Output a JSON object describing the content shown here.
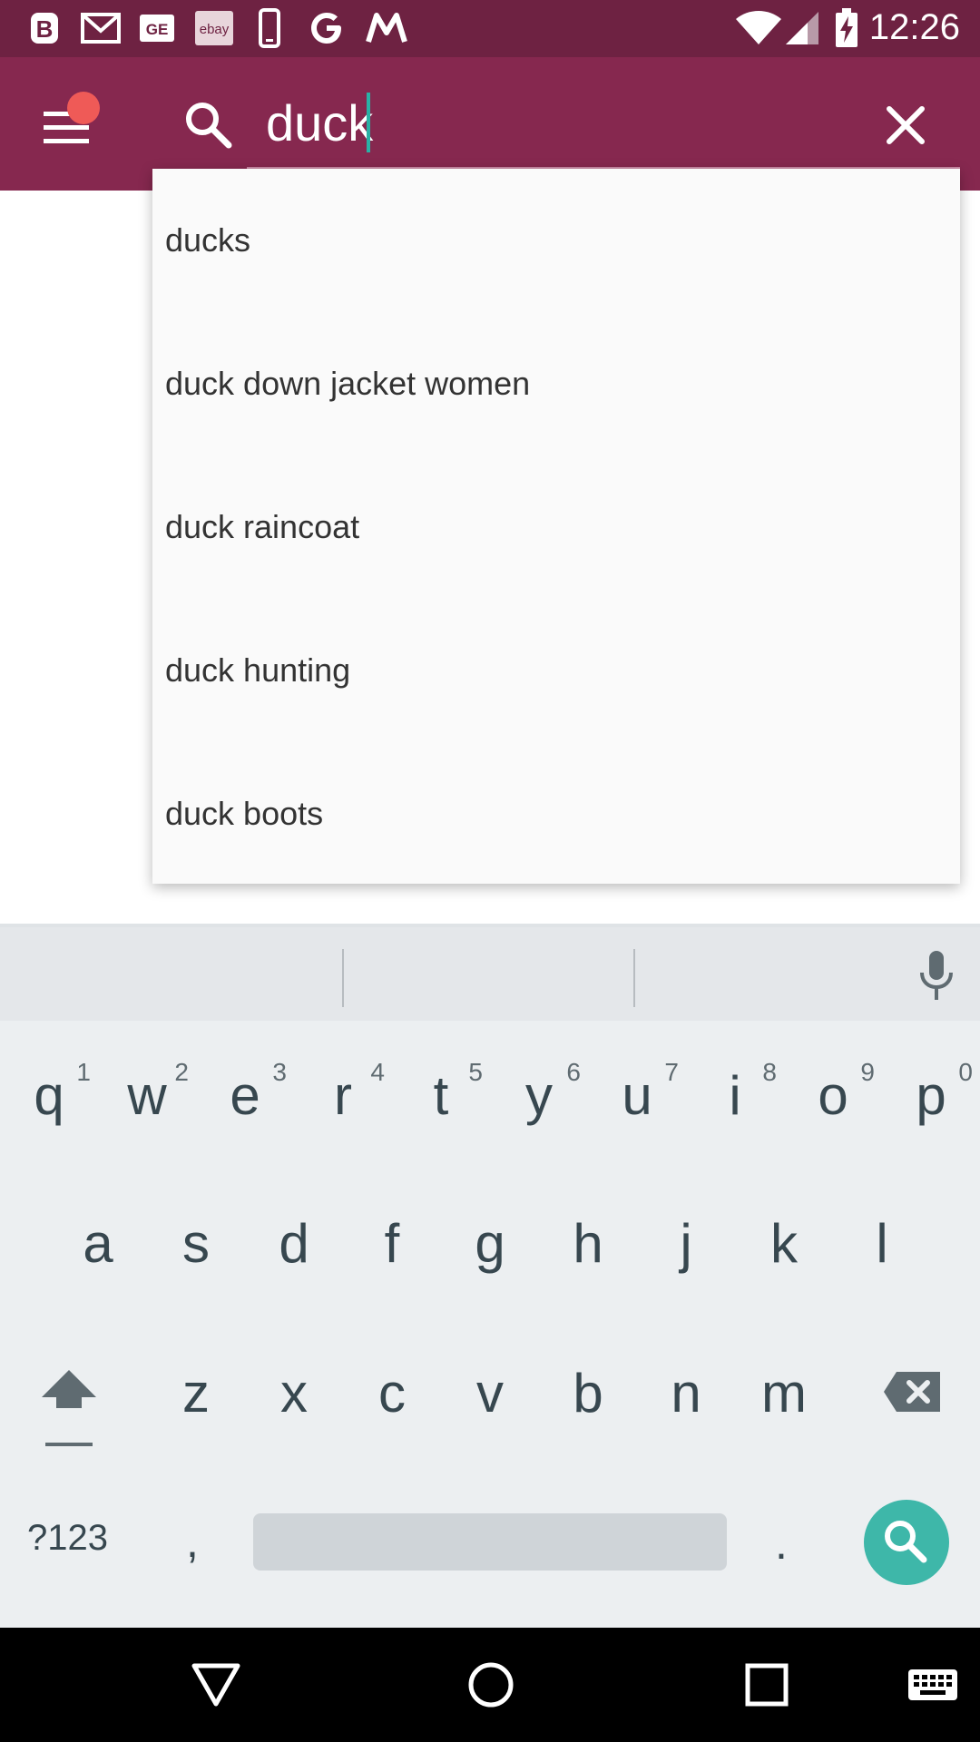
{
  "status_bar": {
    "time": "12:26",
    "notification_icons": [
      "b-app-icon",
      "gmail-icon",
      "ge-icon",
      "ebay-icon",
      "phone-icon",
      "google-icon",
      "myntra-icon"
    ],
    "status_icons": [
      "wifi-icon",
      "signal-icon",
      "battery-charging-icon"
    ],
    "ebay_label": "ebay",
    "ge_label": "GE"
  },
  "app_bar": {
    "search_query": "duck",
    "background_color": "#86284f",
    "notification_dot_color": "#ef5a57"
  },
  "suggestions": [
    "ducks",
    "duck down jacket women",
    "duck raincoat",
    "duck hunting",
    "duck boots"
  ],
  "keyboard": {
    "row1": [
      {
        "ch": "q",
        "hint": "1"
      },
      {
        "ch": "w",
        "hint": "2"
      },
      {
        "ch": "e",
        "hint": "3"
      },
      {
        "ch": "r",
        "hint": "4"
      },
      {
        "ch": "t",
        "hint": "5"
      },
      {
        "ch": "y",
        "hint": "6"
      },
      {
        "ch": "u",
        "hint": "7"
      },
      {
        "ch": "i",
        "hint": "8"
      },
      {
        "ch": "o",
        "hint": "9"
      },
      {
        "ch": "p",
        "hint": "0"
      }
    ],
    "row2": [
      "a",
      "s",
      "d",
      "f",
      "g",
      "h",
      "j",
      "k",
      "l"
    ],
    "row3": [
      "z",
      "x",
      "c",
      "v",
      "b",
      "n",
      "m"
    ],
    "symbols_label": "?123",
    "comma_label": ",",
    "period_label": ".",
    "accent_color": "#3eb7a9"
  },
  "nav_bar": {
    "buttons": [
      "back-icon",
      "home-icon",
      "recents-icon",
      "keyboard-switch-icon"
    ]
  }
}
